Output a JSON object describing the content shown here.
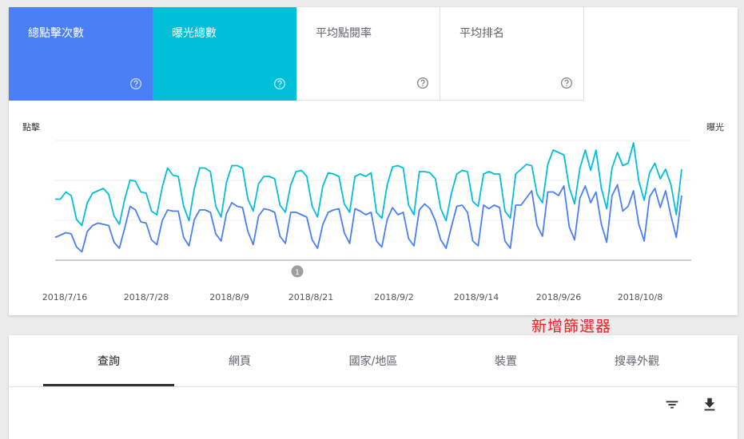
{
  "metrics": [
    {
      "label": "總點擊次數",
      "color": "#4a7ff5",
      "selected": true
    },
    {
      "label": "曝光總數",
      "color": "#02bfd9",
      "selected": true
    },
    {
      "label": "平均點閱率",
      "selected": false
    },
    {
      "label": "平均排名",
      "selected": false
    }
  ],
  "chart": {
    "left_axis_title": "點擊",
    "right_axis_title": "曝光",
    "x_tick_labels": [
      "2018/7/16",
      "2018/7/28",
      "2018/8/9",
      "2018/8/21",
      "2018/9/2",
      "2018/9/14",
      "2018/9/26",
      "2018/10/8"
    ],
    "annotation_marker": "1"
  },
  "chart_data": {
    "type": "line",
    "x_start": "2018/7/13",
    "x_end": "2018/10/11",
    "grid": true,
    "series": [
      {
        "name": "總點擊次數",
        "color": "#4a7ff5",
        "values": [
          19,
          21,
          23,
          22,
          11,
          7,
          24,
          29,
          31,
          30,
          29,
          15,
          10,
          27,
          45,
          42,
          32,
          31,
          17,
          13,
          33,
          42,
          41,
          41,
          19,
          12,
          34,
          42,
          42,
          40,
          22,
          16,
          39,
          48,
          45,
          44,
          24,
          13,
          37,
          43,
          42,
          40,
          20,
          14,
          40,
          40,
          38,
          36,
          17,
          10,
          30,
          40,
          42,
          43,
          23,
          14,
          43,
          41,
          38,
          40,
          16,
          11,
          34,
          44,
          38,
          40,
          18,
          12,
          42,
          47,
          43,
          33,
          17,
          10,
          28,
          45,
          46,
          40,
          16,
          12,
          46,
          43,
          46,
          44,
          16,
          10,
          46,
          46,
          52,
          58,
          29,
          20,
          57,
          57,
          54,
          62,
          28,
          17,
          52,
          62,
          48,
          57,
          30,
          15,
          54,
          63,
          41,
          45,
          58,
          30,
          16,
          53,
          60,
          44,
          58,
          37,
          19,
          54
        ]
      },
      {
        "name": "曝光總數",
        "color": "#02bfd9",
        "values": [
          51,
          51,
          57,
          54,
          34,
          29,
          48,
          56,
          58,
          60,
          55,
          37,
          30,
          51,
          67,
          66,
          57,
          56,
          41,
          38,
          61,
          77,
          71,
          70,
          45,
          33,
          60,
          77,
          77,
          74,
          45,
          36,
          65,
          79,
          79,
          77,
          51,
          41,
          64,
          70,
          70,
          68,
          46,
          40,
          63,
          74,
          75,
          70,
          45,
          36,
          62,
          73,
          72,
          70,
          47,
          40,
          70,
          72,
          70,
          73,
          40,
          35,
          63,
          78,
          79,
          77,
          46,
          38,
          74,
          74,
          73,
          68,
          43,
          33,
          56,
          72,
          75,
          74,
          49,
          45,
          72,
          74,
          72,
          72,
          41,
          35,
          72,
          76,
          80,
          79,
          55,
          48,
          80,
          92,
          90,
          88,
          61,
          47,
          77,
          92,
          75,
          92,
          60,
          43,
          77,
          90,
          79,
          81,
          98,
          66,
          50,
          73,
          81,
          68,
          76,
          63,
          38,
          76
        ]
      }
    ]
  },
  "tabs": [
    "查詢",
    "網頁",
    "國家/地區",
    "裝置",
    "搜尋外觀"
  ],
  "annotation": {
    "text": "新增篩選器",
    "color": "#e8242a"
  }
}
